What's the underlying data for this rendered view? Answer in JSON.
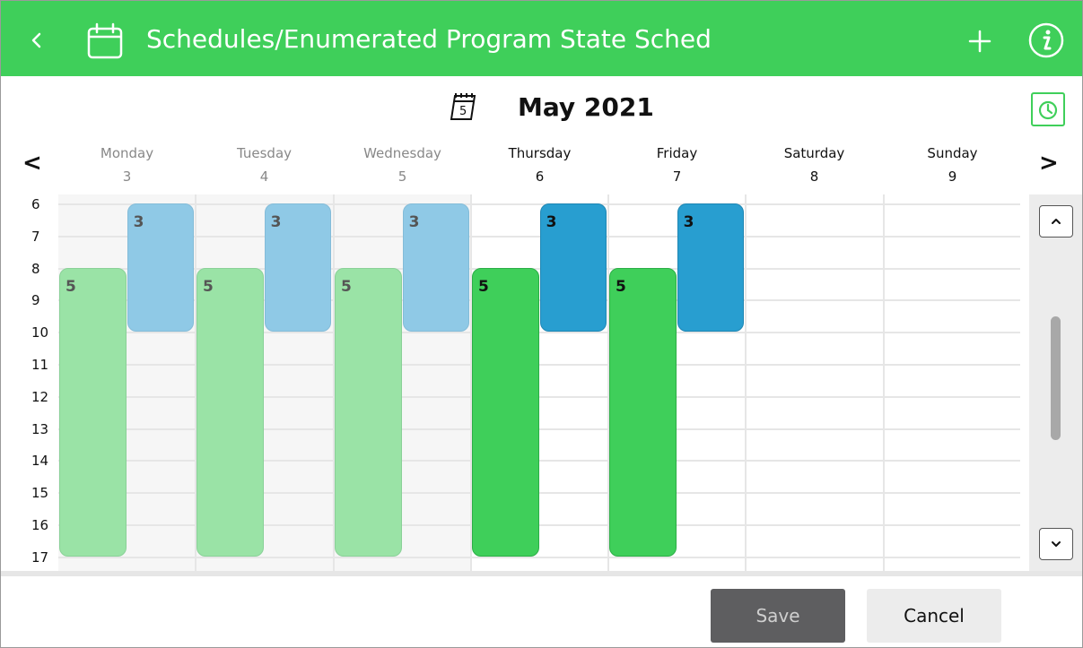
{
  "header": {
    "title": "Schedules/Enumerated Program State Sched",
    "background": "#3fcf5a",
    "back_icon": "chevron-left-icon",
    "calendar_icon": "calendar-icon",
    "add_icon": "plus-icon",
    "info_icon": "info-icon"
  },
  "month": {
    "label": "May 2021",
    "calendar_icon_day": "5",
    "clock_icon": "clock-icon"
  },
  "nav": {
    "prev": "<",
    "next": ">"
  },
  "days": [
    {
      "name": "Monday",
      "num": "3",
      "past": true
    },
    {
      "name": "Tuesday",
      "num": "4",
      "past": true
    },
    {
      "name": "Wednesday",
      "num": "5",
      "past": true
    },
    {
      "name": "Thursday",
      "num": "6",
      "past": false
    },
    {
      "name": "Friday",
      "num": "7",
      "past": false
    },
    {
      "name": "Saturday",
      "num": "8",
      "past": false
    },
    {
      "name": "Sunday",
      "num": "9",
      "past": false
    }
  ],
  "hours": [
    "6",
    "7",
    "8",
    "9",
    "10",
    "11",
    "12",
    "13",
    "14",
    "15",
    "16",
    "17"
  ],
  "events": [
    {
      "day": 0,
      "value": "5",
      "start": 8,
      "end": 17,
      "color": "green"
    },
    {
      "day": 0,
      "value": "3",
      "start": 6,
      "end": 10,
      "color": "blue"
    },
    {
      "day": 1,
      "value": "5",
      "start": 8,
      "end": 17,
      "color": "green"
    },
    {
      "day": 1,
      "value": "3",
      "start": 6,
      "end": 10,
      "color": "blue"
    },
    {
      "day": 2,
      "value": "5",
      "start": 8,
      "end": 17,
      "color": "green"
    },
    {
      "day": 2,
      "value": "3",
      "start": 6,
      "end": 10,
      "color": "blue"
    },
    {
      "day": 3,
      "value": "5",
      "start": 8,
      "end": 17,
      "color": "green"
    },
    {
      "day": 3,
      "value": "3",
      "start": 6,
      "end": 10,
      "color": "blue"
    },
    {
      "day": 4,
      "value": "5",
      "start": 8,
      "end": 17,
      "color": "green"
    },
    {
      "day": 4,
      "value": "3",
      "start": 6,
      "end": 10,
      "color": "blue"
    }
  ],
  "colors": {
    "green": "#3fcf5a",
    "blue": "#289ed0"
  },
  "footer": {
    "save_label": "Save",
    "cancel_label": "Cancel"
  }
}
